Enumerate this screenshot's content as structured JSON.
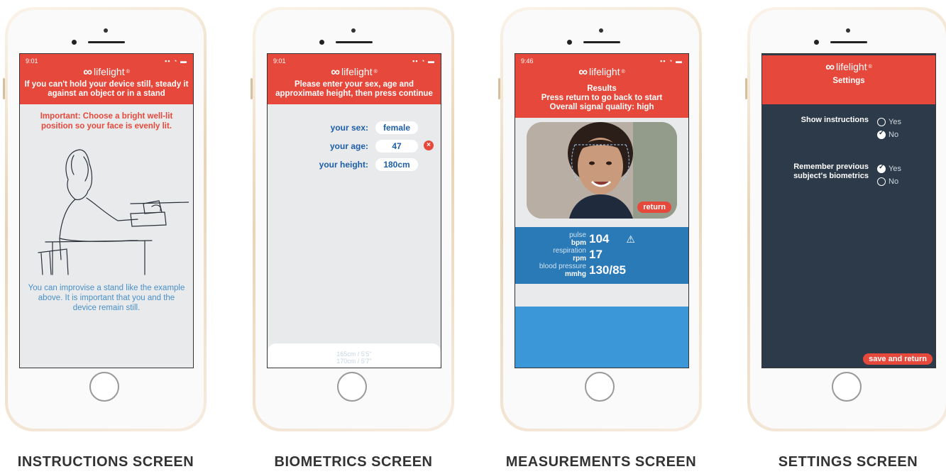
{
  "brand": {
    "name": "lifelight",
    "mark": "®",
    "accent_color": "#e6493b",
    "blue_color": "#2a7ab8"
  },
  "instructions": {
    "time": "9:01",
    "header": "If you can't hold your device still, steady it against an object or in a stand",
    "important": "Important: Choose a bright well-lit position so your face is evenly lit.",
    "hint": "You can improvise a stand like the example above. It is important that you and the device remain still.",
    "caption": "INSTRUCTIONS SCREEN"
  },
  "biometrics": {
    "time": "9:01",
    "header": "Please enter your sex, age and approximate height, then press continue",
    "close_icon": "×",
    "fields": [
      {
        "label": "your sex:",
        "value": "female"
      },
      {
        "label": "your age:",
        "value": "47"
      },
      {
        "label": "your height:",
        "value": "180cm"
      }
    ],
    "picker": [
      "165cm / 5'5\"",
      "170cm / 5'7\""
    ],
    "caption": "BIOMETRICS SCREEN"
  },
  "measurements": {
    "time": "9:46",
    "header_title": "Results",
    "header_line1": "Press return to go back to start",
    "header_line2": "Overall signal quality: high",
    "return_label": "return",
    "rows": [
      {
        "name": "pulse",
        "unit": "bpm",
        "value": "104",
        "warning_icon": "⚠"
      },
      {
        "name": "respiration",
        "unit": "rpm",
        "value": "17"
      },
      {
        "name": "blood pressure",
        "unit": "mmhg",
        "value": "130/85"
      }
    ],
    "caption": "MEASUREMENTS SCREEN"
  },
  "settings": {
    "header": "Settings",
    "options": [
      {
        "question": "Show instructions",
        "yes": "Yes",
        "no": "No",
        "selected": "no"
      },
      {
        "question": "Remember previous subject's biometrics",
        "yes": "Yes",
        "no": "No",
        "selected": "yes"
      }
    ],
    "save_label": "save and return",
    "caption": "SETTINGS SCREEN"
  }
}
